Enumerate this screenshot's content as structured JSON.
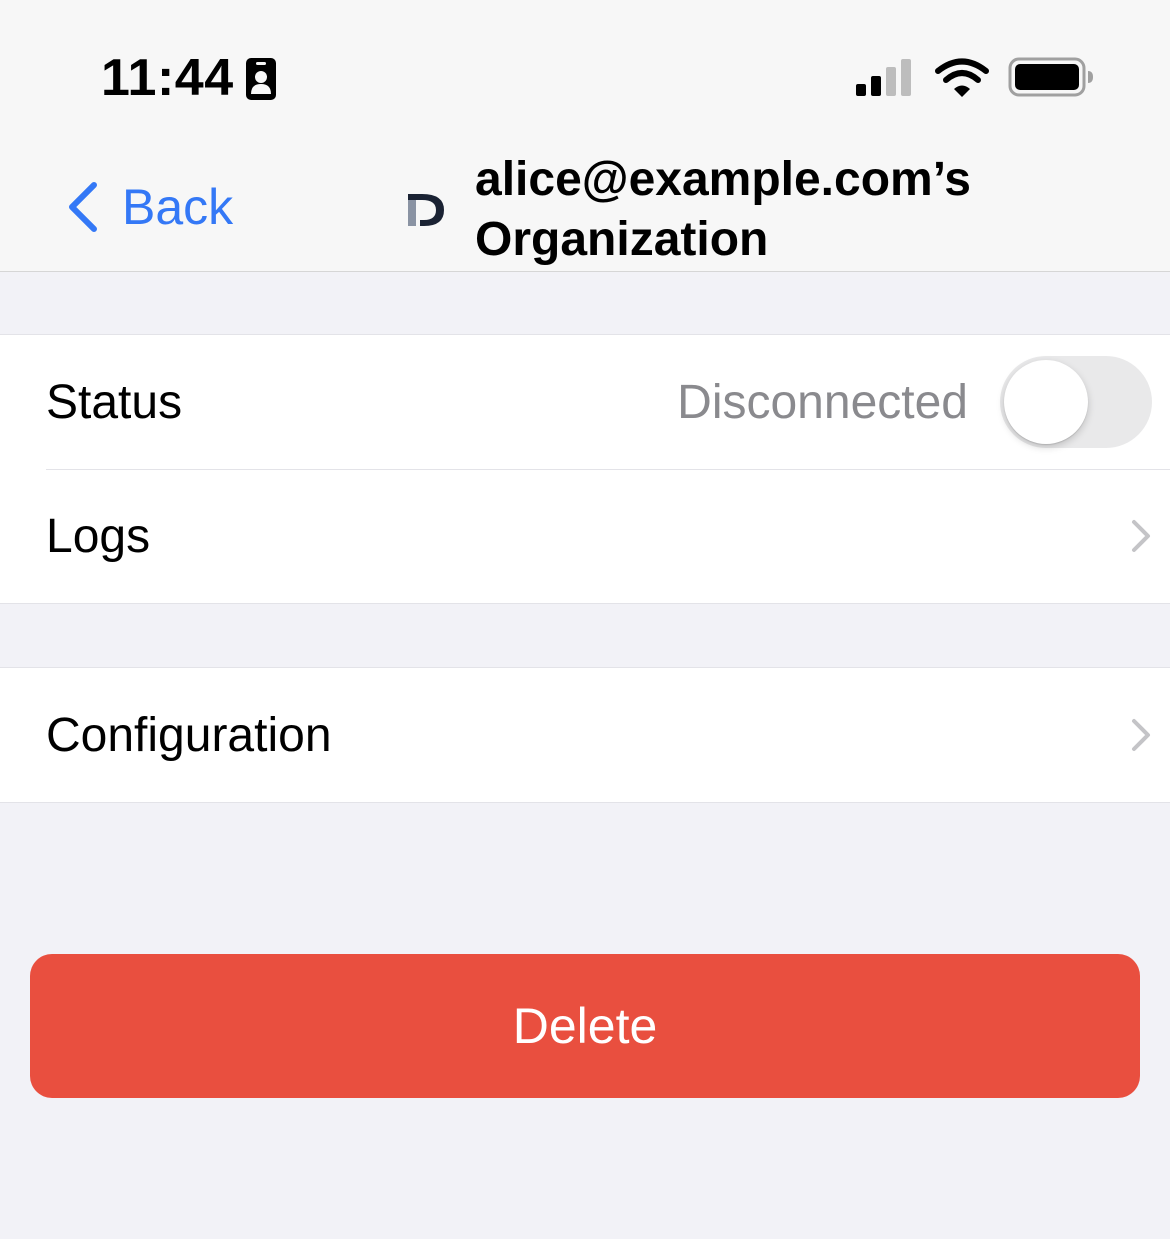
{
  "status_bar": {
    "time": "11:44",
    "icons": [
      "contact-card-icon",
      "cellular-signal-icon",
      "wifi-icon",
      "battery-icon"
    ]
  },
  "nav": {
    "back_label": "Back",
    "title": "alice@example.com’s Organization",
    "logo_icon": "app-logo-icon",
    "accent_color": "#3478f6"
  },
  "sections": [
    {
      "rows": [
        {
          "label": "Status",
          "value": "Disconnected",
          "control": "toggle",
          "toggle_on": false
        },
        {
          "label": "Logs",
          "control": "chevron"
        }
      ]
    },
    {
      "rows": [
        {
          "label": "Configuration",
          "control": "chevron"
        }
      ]
    }
  ],
  "delete_button": {
    "label": "Delete",
    "color": "#e94f3f"
  }
}
